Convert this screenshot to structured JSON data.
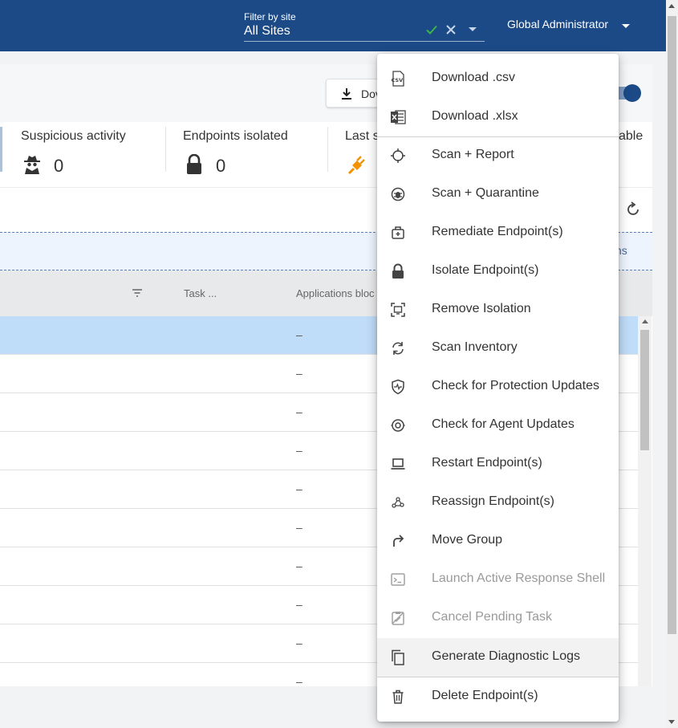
{
  "header": {
    "filter_label": "Filter by site",
    "filter_value": "All Sites",
    "user": "Global Administrator"
  },
  "toolbar": {
    "download_label": "Dov"
  },
  "stats": [
    {
      "label": "Suspicious activity",
      "value": "0",
      "icon": "spy-icon"
    },
    {
      "label": "Endpoints isolated",
      "value": "0",
      "icon": "lock-icon"
    },
    {
      "label": "Last s",
      "value": "",
      "icon": "plug-icon",
      "color": "#f39200"
    }
  ],
  "stats_right_label": "able",
  "dropzone_text": "ns",
  "table": {
    "columns": [
      "Task ...",
      "Applications bloc"
    ],
    "rows": [
      "–",
      "–",
      "–",
      "–",
      "–",
      "–",
      "–",
      "–",
      "–",
      "–"
    ]
  },
  "menu": {
    "items": [
      {
        "label": "Download .csv",
        "icon": "csv-icon",
        "disabled": false
      },
      {
        "label": "Download .xlsx",
        "icon": "excel-icon",
        "disabled": false
      },
      {
        "label": "Scan + Report",
        "icon": "crosshair-icon",
        "disabled": false
      },
      {
        "label": "Scan + Quarantine",
        "icon": "bug-icon",
        "disabled": false
      },
      {
        "label": "Remediate Endpoint(s)",
        "icon": "medkit-icon",
        "disabled": false
      },
      {
        "label": "Isolate Endpoint(s)",
        "icon": "lock-icon",
        "disabled": false
      },
      {
        "label": "Remove Isolation",
        "icon": "unisolate-icon",
        "disabled": false
      },
      {
        "label": "Scan Inventory",
        "icon": "sync-icon",
        "disabled": false
      },
      {
        "label": "Check for Protection Updates",
        "icon": "shield-pulse-icon",
        "disabled": false
      },
      {
        "label": "Check for Agent Updates",
        "icon": "agent-update-icon",
        "disabled": false
      },
      {
        "label": "Restart Endpoint(s)",
        "icon": "laptop-icon",
        "disabled": false
      },
      {
        "label": "Reassign Endpoint(s)",
        "icon": "graph-icon",
        "disabled": false
      },
      {
        "label": "Move Group",
        "icon": "redo-arrow-icon",
        "disabled": false
      },
      {
        "label": "Launch Active Response Shell",
        "icon": "terminal-icon",
        "disabled": true
      },
      {
        "label": "Cancel Pending Task",
        "icon": "cancel-task-icon",
        "disabled": true
      },
      {
        "label": "Generate Diagnostic Logs",
        "icon": "copy-icon",
        "disabled": false
      },
      {
        "label": "Delete Endpoint(s)",
        "icon": "trash-icon",
        "disabled": false
      }
    ]
  },
  "colors": {
    "header_bg": "#1b4a86",
    "selected_row": "#bfdcf8",
    "accent_orange": "#f39200",
    "check_green": "#3cb44b"
  }
}
